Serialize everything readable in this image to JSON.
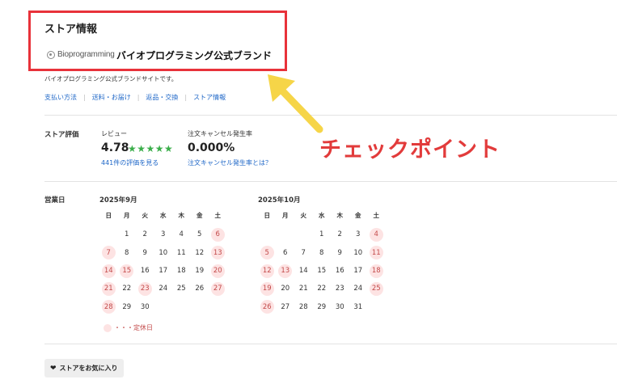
{
  "store": {
    "section_title": "ストア情報",
    "logo_text": "Bioprogramming",
    "brand_name": "バイオプログラミング公式ブランド",
    "description": "バイオプログラミング公式ブランドサイトです。"
  },
  "links": [
    "支払い方法",
    "送料・お届け",
    "返品・交換",
    "ストア情報"
  ],
  "rating": {
    "label": "ストア評価",
    "review_heading": "レビュー",
    "score": "4.78",
    "stars": "★★★★★",
    "review_link": "441件の評価を見る",
    "cancel_heading": "注文キャンセル発生率",
    "cancel_rate": "0.000%",
    "cancel_link": "注文キャンセル発生率とは？"
  },
  "annotation": {
    "text": "チェックポイント",
    "color": "#e23b3b",
    "arrow_color": "#f6d548"
  },
  "business_days": {
    "label": "営業日",
    "weekdays": [
      "日",
      "月",
      "火",
      "水",
      "木",
      "金",
      "土"
    ],
    "months": [
      {
        "title": "2025年9月",
        "leading_blanks": 1,
        "days": 30,
        "holidays": [
          6,
          7,
          13,
          14,
          15,
          20,
          21,
          23,
          27,
          28
        ]
      },
      {
        "title": "2025年10月",
        "leading_blanks": 3,
        "days": 31,
        "holidays": [
          4,
          5,
          11,
          12,
          13,
          18,
          19,
          25,
          26
        ]
      }
    ],
    "legend": "・・・定休日"
  },
  "favorite_button": "ストアをお気に入り",
  "colors": {
    "link": "#2068c8",
    "star": "#3aae4a",
    "holiday_bg": "#fde3e3",
    "highlight_border": "#e8323a"
  }
}
